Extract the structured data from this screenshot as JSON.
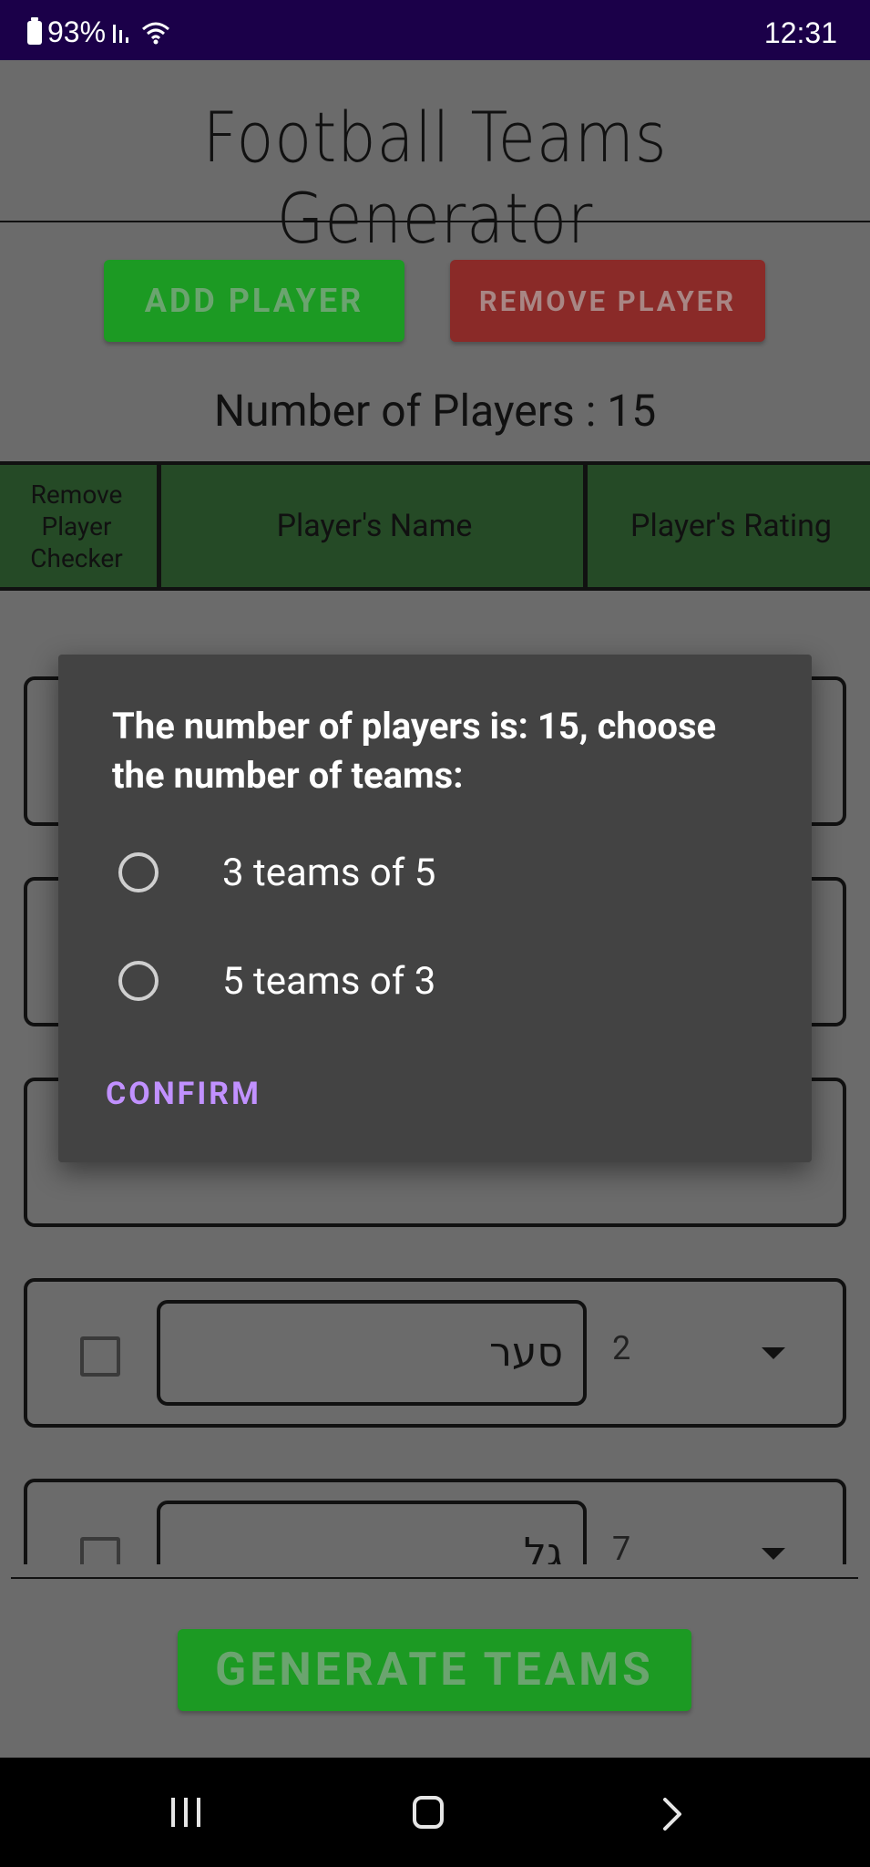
{
  "status_bar": {
    "battery": "93%",
    "time": "12:31"
  },
  "app": {
    "title": "Football Teams Generator",
    "add_button": "ADD PLAYER",
    "remove_button": "REMOVE PLAYER",
    "player_count": "Number of Players : 15",
    "table_headers": {
      "remove_checker": "Remove Player Checker",
      "name": "Player's Name",
      "rating": "Player's Rating"
    },
    "rows": [
      {
        "name": "",
        "rating": ""
      },
      {
        "name": "",
        "rating": ""
      },
      {
        "name": "",
        "rating": ""
      },
      {
        "name": "סער",
        "rating": "2"
      },
      {
        "name": "גל",
        "rating": "7"
      }
    ],
    "generate_button": "GENERATE TEAMS"
  },
  "dialog": {
    "title": "The number of players is: 15, choose the number of teams:",
    "options": [
      "3 teams of 5",
      "5 teams of 3"
    ],
    "confirm": "CONFIRM"
  },
  "colors": {
    "status_bar": "#1b0049",
    "green_button": "#1c9a23",
    "red_button": "#8a2a28",
    "header_green": "#254a26",
    "dialog_bg": "#434343",
    "accent": "#c191ff"
  },
  "icons": {
    "battery": "battery-icon",
    "signal": "signal-icon",
    "wifi": "wifi-icon",
    "dropdown": "dropdown-icon",
    "nav_recent": "recent-apps-icon",
    "nav_home": "home-icon",
    "nav_back": "back-icon"
  }
}
